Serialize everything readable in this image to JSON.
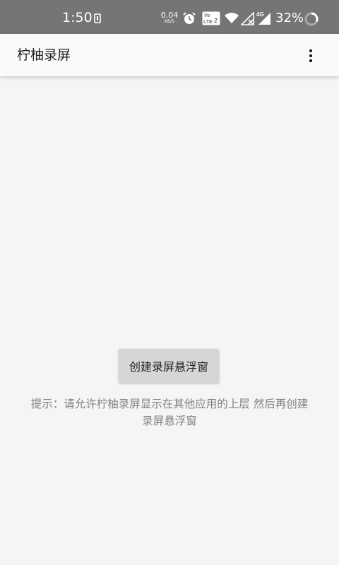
{
  "status_bar": {
    "time": "1:50",
    "net_speed_value": "0.04",
    "net_speed_unit": "KB/S",
    "volte_label": "Vo LTE 2",
    "network_label": "4G",
    "battery": "32%",
    "icons": [
      "sim-toolkit-icon",
      "alarm-icon",
      "volte-icon",
      "wifi-icon",
      "signal-no-sim-icon",
      "signal-4g-icon",
      "battery-ring-icon"
    ]
  },
  "app_bar": {
    "title": "柠柚录屏",
    "menu_icon": "more-vert-icon"
  },
  "main": {
    "create_button_label": "创建录屏悬浮窗",
    "hint": "提示：请允许柠柚录屏显示在其他应用的上层 然后再创建录屏悬浮窗"
  },
  "colors": {
    "status_bar_bg": "#757575",
    "app_bar_bg": "#fafafa",
    "page_bg": "#f5f5f5",
    "button_bg": "#d6d6d6",
    "hint_text": "#808080"
  }
}
